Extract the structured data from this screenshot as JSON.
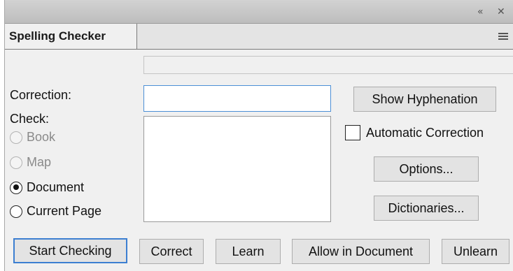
{
  "titlebar": {
    "collapse_glyph": "«",
    "close_glyph": "✕"
  },
  "tab": {
    "label": "Spelling Checker"
  },
  "labels": {
    "correction": "Correction:",
    "check": "Check:"
  },
  "check_options": [
    {
      "label": "Book",
      "enabled": false,
      "selected": false
    },
    {
      "label": "Map",
      "enabled": false,
      "selected": false
    },
    {
      "label": "Document",
      "enabled": true,
      "selected": true
    },
    {
      "label": "Current Page",
      "enabled": true,
      "selected": false
    }
  ],
  "correction_input": {
    "value": ""
  },
  "side_buttons": {
    "show_hyphenation": "Show Hyphenation",
    "automatic_correction": "Automatic Correction",
    "automatic_correction_checked": false,
    "options": "Options...",
    "dictionaries": "Dictionaries..."
  },
  "bottom_buttons": {
    "start_checking": "Start Checking",
    "correct": "Correct",
    "learn": "Learn",
    "allow_in_document": "Allow in Document",
    "unlearn": "Unlearn"
  },
  "colors": {
    "focus_accent": "#3c7fd1"
  }
}
